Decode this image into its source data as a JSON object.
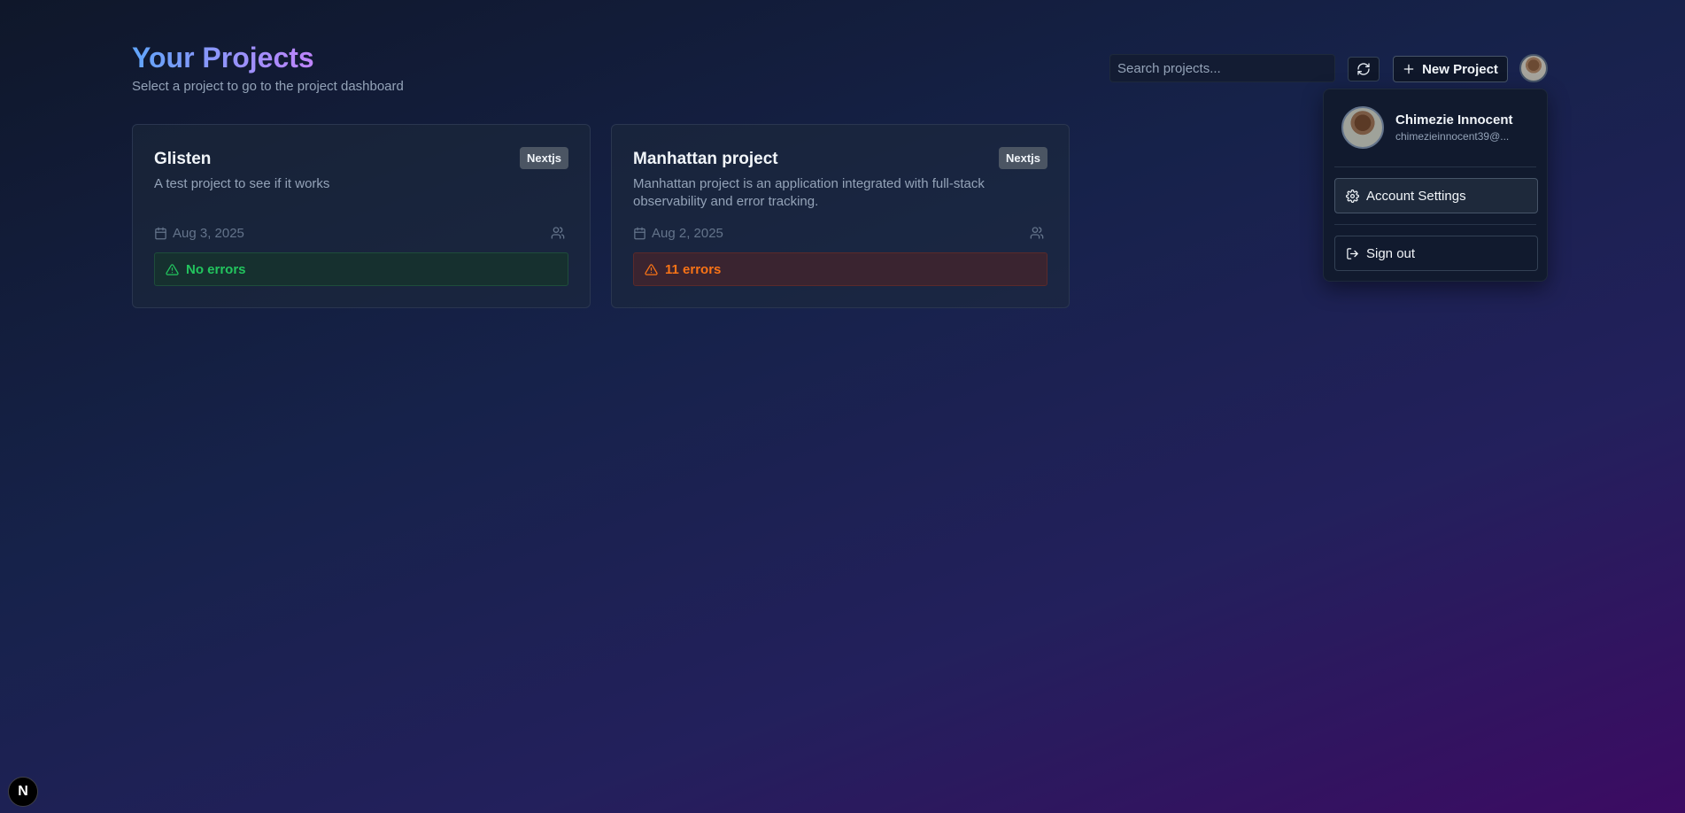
{
  "header": {
    "title": "Your Projects",
    "subtitle": "Select a project to go to the project dashboard"
  },
  "toolbar": {
    "search_placeholder": "Search projects...",
    "new_project_label": "New Project"
  },
  "projects": [
    {
      "name": "Glisten",
      "framework": "Nextjs",
      "description": "A test project to see if it works",
      "date": "Aug 3, 2025",
      "status": "No errors",
      "status_type": "ok"
    },
    {
      "name": "Manhattan project",
      "framework": "Nextjs",
      "description": "Manhattan project is an application integrated with full-stack observability and error tracking.",
      "date": "Aug 2, 2025",
      "status": "11 errors",
      "status_type": "error"
    }
  ],
  "user_menu": {
    "name": "Chimezie Innocent",
    "email": "chimezieinnocent39@...",
    "account_settings_label": "Account Settings",
    "sign_out_label": "Sign out"
  },
  "dev_badge": {
    "label": "N"
  },
  "colors": {
    "success": "#22c55e",
    "error": "#f97316",
    "accent_from": "#60a5fa",
    "accent_to": "#c084fc"
  },
  "icons": [
    "refresh-icon",
    "plus-icon",
    "calendar-icon",
    "users-icon",
    "alert-triangle-icon",
    "gear-icon",
    "log-out-icon"
  ]
}
